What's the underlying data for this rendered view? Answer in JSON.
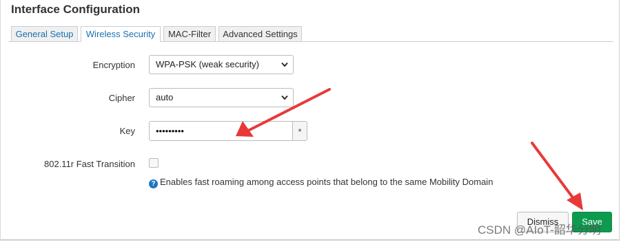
{
  "dialog": {
    "title": "Interface Configuration",
    "tabs": [
      {
        "label": "General Setup",
        "active": false
      },
      {
        "label": "Wireless Security",
        "active": true
      },
      {
        "label": "MAC-Filter",
        "active": false
      },
      {
        "label": "Advanced Settings",
        "active": false
      }
    ]
  },
  "form": {
    "encryption": {
      "label": "Encryption",
      "value": "WPA-PSK (weak security)"
    },
    "cipher": {
      "label": "Cipher",
      "value": "auto"
    },
    "key": {
      "label": "Key",
      "value": "•••••••••",
      "reveal_label": "*"
    },
    "fast_transition": {
      "label": "802.11r Fast Transition",
      "checked": false,
      "help_icon": "?",
      "help": "Enables fast roaming among access points that belong to the same Mobility Domain"
    }
  },
  "actions": {
    "dismiss": "Dismiss",
    "save": "Save"
  },
  "watermark": "CSDN @AIoT-韶华分明",
  "colors": {
    "accent": "#1a6fb0",
    "save": "#0e9a4f",
    "arrow": "#e8393a"
  }
}
